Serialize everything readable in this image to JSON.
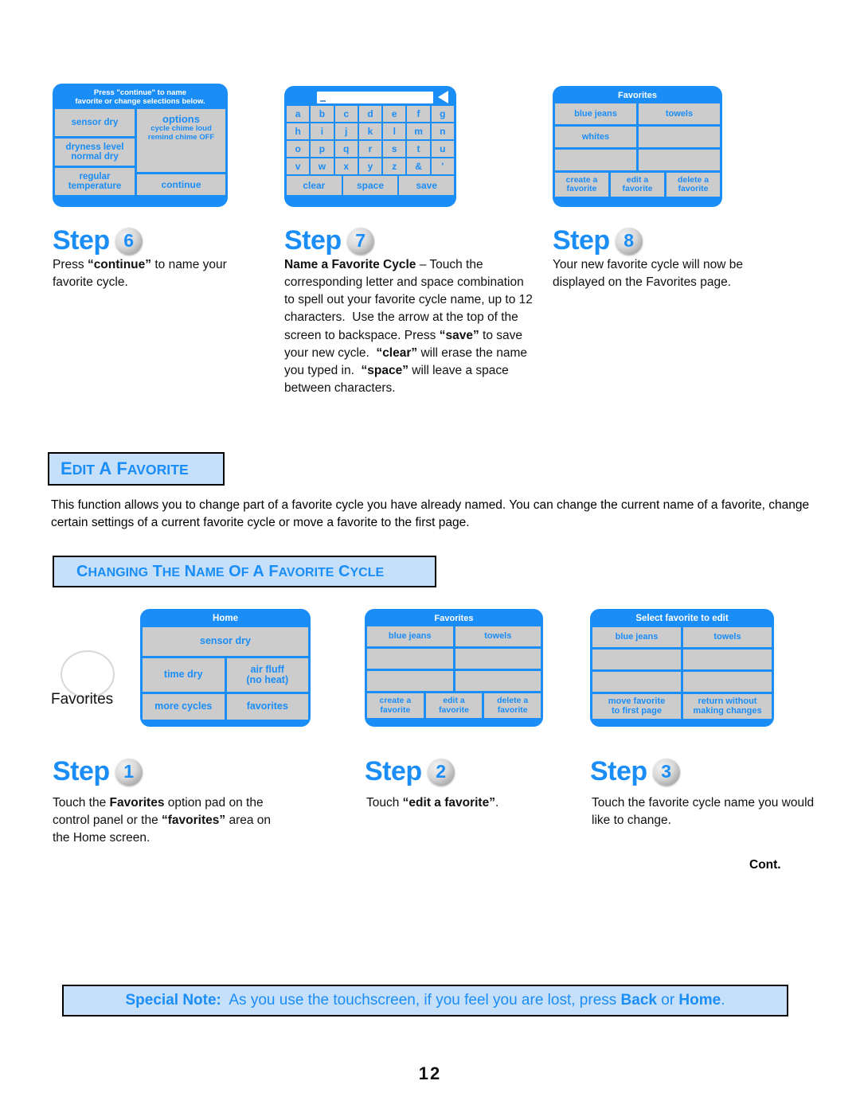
{
  "colors": {
    "brand_blue": "#1b8df7",
    "panel_gray": "#cccccc",
    "header_fill": "#c5e0f8"
  },
  "screens": {
    "continue_screen": {
      "title_line1": "Press \"continue\" to name",
      "title_line2": "favorite or change selections below.",
      "left_pads": [
        "sensor dry",
        "dryness level\nnormal dry",
        "regular\ntemperature"
      ],
      "left_pad_1": "sensor dry",
      "left_pad_2a": "dryness level",
      "left_pad_2b": "normal dry",
      "left_pad_3a": "regular",
      "left_pad_3b": "temperature",
      "options_title": "options",
      "options_line1": "cycle chime loud",
      "options_line2": "remind chime OFF",
      "continue_label": "continue"
    },
    "keyboard_screen": {
      "field_value": "",
      "backspace_icon": "left-arrow-icon",
      "rows": [
        [
          "a",
          "b",
          "c",
          "d",
          "e",
          "f",
          "g"
        ],
        [
          "h",
          "i",
          "j",
          "k",
          "l",
          "m",
          "n"
        ],
        [
          "o",
          "p",
          "q",
          "r",
          "s",
          "t",
          "u"
        ],
        [
          "v",
          "w",
          "x",
          "y",
          "z",
          "&",
          "'"
        ]
      ],
      "clear_label": "clear",
      "space_label": "space",
      "save_label": "save"
    },
    "favorites_step8": {
      "title": "Favorites",
      "cells": [
        [
          "blue jeans",
          "towels"
        ],
        [
          "whites",
          ""
        ],
        [
          "",
          ""
        ]
      ],
      "actions": [
        "create a\nfavorite",
        "edit a\nfavorite",
        "delete a\nfavorite"
      ],
      "action_1a": "create a",
      "action_1b": "favorite",
      "action_2a": "edit a",
      "action_2b": "favorite",
      "action_3a": "delete a",
      "action_3b": "favorite"
    },
    "home_screen": {
      "title": "Home",
      "pad_sensor_dry": "sensor dry",
      "pad_time_dry": "time dry",
      "pad_air_fluff": "air fluff",
      "pad_air_fluff_sub": "(no heat)",
      "pad_more_cycles": "more cycles",
      "pad_favorites": "favorites",
      "knob_label": "Favorites"
    },
    "favorites_step2": {
      "title": "Favorites",
      "cells": [
        [
          "blue jeans",
          "towels"
        ],
        [
          "",
          ""
        ],
        [
          "",
          ""
        ]
      ],
      "action_1a": "create a",
      "action_1b": "favorite",
      "action_2a": "edit a",
      "action_2b": "favorite",
      "action_3a": "delete a",
      "action_3b": "favorite"
    },
    "select_favorite_screen": {
      "title": "Select favorite to edit",
      "cells": [
        [
          "blue jeans",
          "towels"
        ],
        [
          "",
          ""
        ],
        [
          "",
          ""
        ]
      ],
      "action_1a": "move favorite",
      "action_1b": "to first page",
      "action_2a": "return without",
      "action_2b": "making changes"
    }
  },
  "steps_top": [
    {
      "word": "Step",
      "number": "6",
      "body_html": "Press <b>&ldquo;continue&rdquo;</b> to name your favorite cycle."
    },
    {
      "word": "Step",
      "number": "7",
      "body_html": "<b>Name a Favorite Cycle</b> &ndash; Touch the corresponding letter and space combination to spell out your favorite cycle name, up to 12 characters.&nbsp; Use the arrow at the top of the screen to backspace. Press <b>&ldquo;save&rdquo;</b> to save your new cycle.&nbsp; <b>&ldquo;clear&rdquo;</b> will erase the name you typed in.&nbsp; <b>&ldquo;space&rdquo;</b> will leave a space between characters."
    },
    {
      "word": "Step",
      "number": "8",
      "body_html": "Your new favorite cycle will now be displayed on the Favorites page."
    }
  ],
  "steps_bottom": [
    {
      "word": "Step",
      "number": "1",
      "body_html": "Touch the <b>Favorites</b> option pad on the control panel or the <b>&ldquo;favorites&rdquo;</b> area on the Home screen."
    },
    {
      "word": "Step",
      "number": "2",
      "body_html": "Touch <b>&ldquo;edit a favorite&rdquo;</b>."
    },
    {
      "word": "Step",
      "number": "3",
      "body_html": "Touch the favorite cycle name you would like to change."
    }
  ],
  "sections": {
    "edit_favorite_header": "EDIT A FAVORITE",
    "edit_favorite_header_parts": [
      "E",
      "DIT",
      " A ",
      "F",
      "AVORITE"
    ],
    "intro_paragraph": "This function allows you to change part of a favorite cycle you have already named. You can change the current name of a favorite, change certain settings of a current favorite cycle or move a favorite to the first page.",
    "changing_name_header": "CHANGING THE NAME OF A FAVORITE CYCLE"
  },
  "footer": {
    "cont_label": "Cont.",
    "note_html": "<b>Special Note:</b>&nbsp; As you use the touchscreen, if you feel you are lost, press <b>Back</b> or <b>Home</b>.",
    "page_number": "12"
  }
}
